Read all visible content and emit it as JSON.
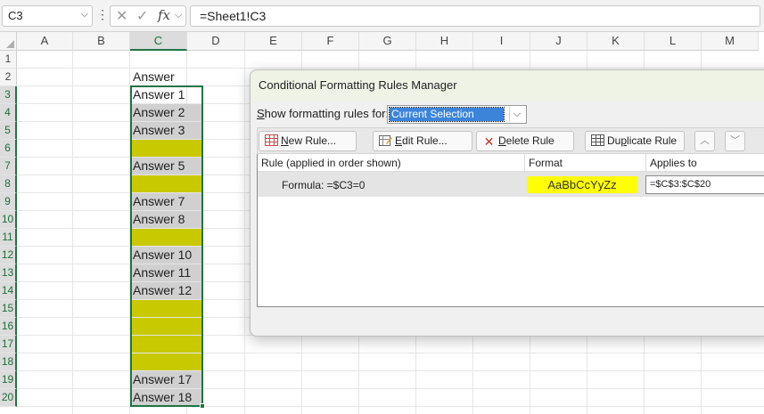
{
  "formula_bar": {
    "name_box": "C3",
    "cancel_glyph": "✕",
    "enter_glyph": "✓",
    "fx_label": "fx",
    "formula": "=Sheet1!C3"
  },
  "columns": [
    "A",
    "B",
    "C",
    "D",
    "E",
    "F",
    "G",
    "H",
    "I",
    "J",
    "K",
    "L",
    "M"
  ],
  "selected_column": "C",
  "rows": [
    "1",
    "2",
    "3",
    "4",
    "5",
    "6",
    "7",
    "8",
    "9",
    "10",
    "11",
    "12",
    "13",
    "14",
    "15",
    "16",
    "17",
    "18",
    "19",
    "20"
  ],
  "cells": [
    {
      "row": "2",
      "text": "Answer",
      "fill": "none"
    },
    {
      "row": "3",
      "text": "Answer 1",
      "fill": "none"
    },
    {
      "row": "4",
      "text": "Answer 2",
      "fill": "gray"
    },
    {
      "row": "5",
      "text": "Answer 3",
      "fill": "gray"
    },
    {
      "row": "6",
      "text": "",
      "fill": "yellow"
    },
    {
      "row": "7",
      "text": "Answer 5",
      "fill": "gray"
    },
    {
      "row": "8",
      "text": "",
      "fill": "yellow"
    },
    {
      "row": "9",
      "text": "Answer 7",
      "fill": "gray"
    },
    {
      "row": "10",
      "text": "Answer 8",
      "fill": "gray"
    },
    {
      "row": "11",
      "text": "",
      "fill": "yellow"
    },
    {
      "row": "12",
      "text": "Answer 10",
      "fill": "gray"
    },
    {
      "row": "13",
      "text": "Answer 11",
      "fill": "gray"
    },
    {
      "row": "14",
      "text": "Answer 12",
      "fill": "gray"
    },
    {
      "row": "15",
      "text": "",
      "fill": "yellow"
    },
    {
      "row": "16",
      "text": "",
      "fill": "yellow"
    },
    {
      "row": "17",
      "text": "",
      "fill": "yellow"
    },
    {
      "row": "18",
      "text": "",
      "fill": "yellow"
    },
    {
      "row": "19",
      "text": "Answer 17",
      "fill": "gray"
    },
    {
      "row": "20",
      "text": "Answer 18",
      "fill": "gray"
    }
  ],
  "colors": {
    "gray_fill": "#d0d0d0",
    "yellow_fill": "#c9c900",
    "selection": "#217346",
    "preview_yellow": "#ffff00"
  },
  "dialog": {
    "title": "Conditional Formatting Rules Manager",
    "show_rules_label": "Show formatting rules for:",
    "show_rules_value": "Current Selection",
    "buttons": {
      "new_rule": "New Rule...",
      "edit_rule": "Edit Rule...",
      "delete_rule": "Delete Rule",
      "duplicate_rule": "Duplicate Rule"
    },
    "headers": {
      "rule": "Rule (applied in order shown)",
      "format": "Format",
      "applies_to": "Applies to"
    },
    "rules": [
      {
        "rule": "Formula: =$C3=0",
        "format_preview": "AaBbCcYyZz",
        "applies_to": "=$C$3:$C$20"
      }
    ]
  }
}
